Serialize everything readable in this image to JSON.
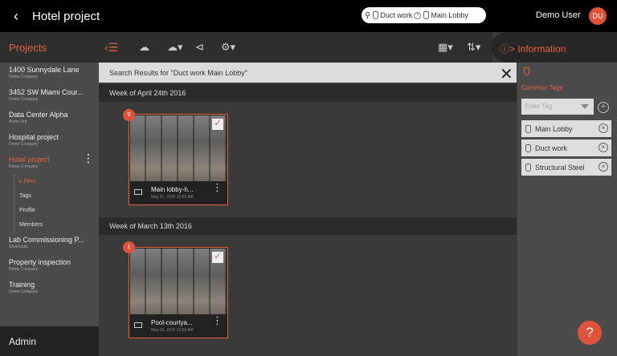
{
  "header": {
    "back_icon": "chevron-left-icon",
    "title": "Hotel project",
    "search_chips": [
      {
        "label": "Duct work"
      },
      {
        "label": "Main Lobby"
      }
    ],
    "user_name": "Demo User",
    "avatar_initials": "DU"
  },
  "sidebar": {
    "heading": "Projects",
    "projects": [
      {
        "name": "1400 Sunnydale Lane",
        "company": "Demo Company"
      },
      {
        "name": "3452 SW Miami Cour...",
        "company": "Demo Company"
      },
      {
        "name": "Data Center Alpha",
        "company": "Acme Org"
      },
      {
        "name": "Hospital project",
        "company": "Demo Company"
      },
      {
        "name": "Hotel project",
        "company": "Demo Company",
        "active": true
      },
      {
        "name": "Lab Commissioning P...",
        "company": "Smartvidio"
      },
      {
        "name": "Property inspection",
        "company": "Demo Company"
      },
      {
        "name": "Training",
        "company": "Demo Company"
      }
    ],
    "subitems": [
      "Files",
      "Tags",
      "Profile",
      "Members"
    ],
    "admin_label": "Admin"
  },
  "info": {
    "heading": "Information",
    "common_tags_label": "Common Tags",
    "enter_tag_placeholder": "Enter Tag",
    "tags": [
      "Main Lobby",
      "Duct work",
      "Structural Steel"
    ]
  },
  "results": {
    "label": "Search Results for \"Duct work Main Lobby\"",
    "weeks": [
      {
        "label": "Week of April 24th 2016",
        "count": "9",
        "file": "Main lobby-h...",
        "date": "May 01, 2016 10:03 AM"
      },
      {
        "label": "Week of March 13th 2016",
        "count": "1",
        "file": "Pool-courtya...",
        "date": "May 01, 2016 10:03 AM"
      }
    ]
  },
  "accent": "#e8613f"
}
